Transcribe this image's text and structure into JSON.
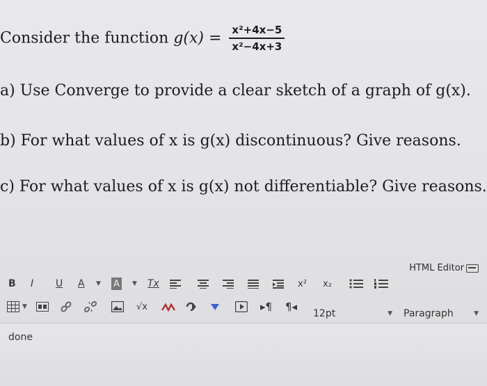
{
  "problem": {
    "intro": "Consider the function",
    "function_lhs": "g(x) =",
    "numerator": "x²+4x−5",
    "denominator": "x²−4x+3",
    "question_a": "a) Use Converge to provide a clear sketch of a graph of g(x).",
    "question_b": "b) For what values of x is g(x) discontinuous? Give reasons.",
    "question_c": "c) For what values of x is g(x) not differentiable? Give reasons."
  },
  "editor": {
    "mode_label": "HTML Editor",
    "toolbar": {
      "bold": "B",
      "italic": "I",
      "underline": "U",
      "font_color": "A",
      "highlight": "A",
      "clear_format": "Tx",
      "superscript": "x²",
      "subscript": "x₂",
      "equation": "√x",
      "ltr": "¶",
      "rtl": "¶"
    },
    "font_size": "12pt",
    "block_format": "Paragraph",
    "content": "done"
  },
  "colors": {
    "link_icon": "#6a6a6e",
    "media_icon": "#3b63c9",
    "chem_icon": "#b0322f"
  }
}
